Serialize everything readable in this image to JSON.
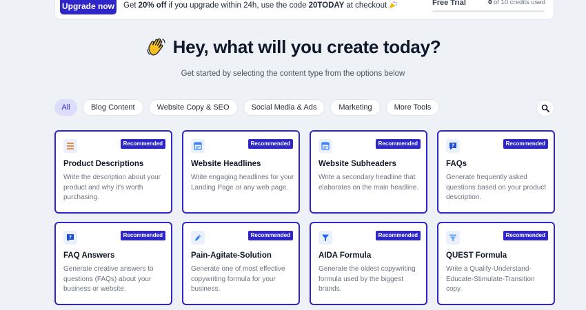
{
  "banner": {
    "upgrade_label": "Upgrade now",
    "promo_prefix": "Get",
    "promo_bold": "20% off",
    "promo_middle": "if you upgrade within 24h, use the code",
    "promo_code": "20TODAY",
    "promo_suffix": "at checkout",
    "promo_icon": "party-popper-icon",
    "trial_label": "Free Trial",
    "credits_used": "0",
    "credits_text": "of 10 credits used",
    "credits_fraction": 0
  },
  "hero": {
    "emoji": "waving-hand-icon",
    "title": "Hey, what will you create today?",
    "subtitle": "Get started by selecting the content type from the options below"
  },
  "filters": [
    "All",
    "Blog Content",
    "Website Copy & SEO",
    "Social Media & Ads",
    "Marketing",
    "More Tools"
  ],
  "active_filter": "All",
  "badge_label": "Recommended",
  "cards": [
    {
      "title": "Product Descriptions",
      "desc": "Write the description about your product and why it's worth purchasing.",
      "icon": "list-icon",
      "accent": "#f08a3c"
    },
    {
      "title": "Website Headlines",
      "desc": "Write engaging headlines for your Landing Page or any web page.",
      "icon": "layout-icon",
      "accent": "#3b82f6"
    },
    {
      "title": "Website Subheaders",
      "desc": "Write a secondary headline that elaborates on the main headline.",
      "icon": "layout-icon",
      "accent": "#3b82f6"
    },
    {
      "title": "FAQs",
      "desc": "Generate frequently asked questions based on your product description.",
      "icon": "question-icon",
      "accent": "#1d4ed8"
    },
    {
      "title": "FAQ Answers",
      "desc": "Generate creative answers to questions (FAQs) about your business or website.",
      "icon": "question-icon",
      "accent": "#1d4ed8"
    },
    {
      "title": "Pain-Agitate-Solution",
      "desc": "Generate one of most effective copywriting formula for your business.",
      "icon": "pen-icon",
      "accent": "#3b82f6"
    },
    {
      "title": "AIDA Formula",
      "desc": "Generate the oldest copywriting formula used by the biggest brands.",
      "icon": "funnel-icon",
      "accent": "#2563eb"
    },
    {
      "title": "QUEST Formula",
      "desc": "Write a Qualify-Understand-Educate-Stimulate-Transition copy.",
      "icon": "funnel-icon",
      "accent": "#60a5fa"
    }
  ]
}
